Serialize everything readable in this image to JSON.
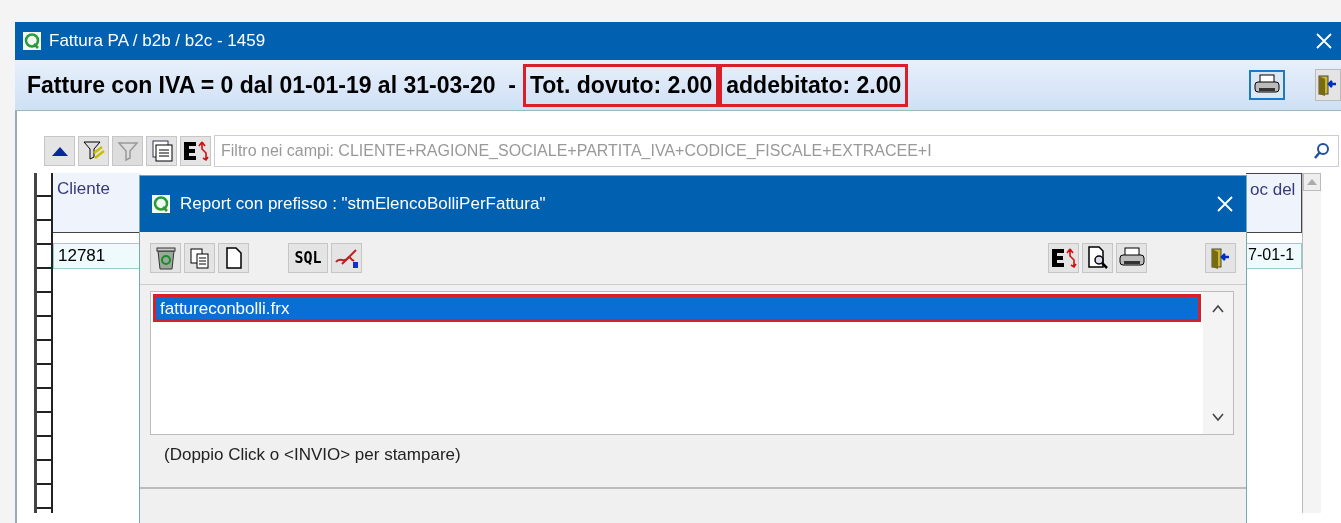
{
  "window": {
    "title": "Fattura PA / b2b / b2c - 1459"
  },
  "header": {
    "segments": [
      {
        "text": "Fatture con IVA = 0 dal 01-01-19 al 31-03-20  -",
        "highlighted": false
      },
      {
        "text": "Tot. dovuto: 2.00",
        "highlighted": true
      },
      {
        "text": "addebitato: 2.00",
        "highlighted": true
      }
    ]
  },
  "filter": {
    "placeholder": "Filtro nei campi: CLIENTE+RAGIONE_SOCIALE+PARTITA_IVA+CODICE_FISCALE+EXTRACEE+I"
  },
  "grid": {
    "columns": [
      "Cliente",
      "oc del"
    ],
    "rows": [
      [
        "12781",
        "7-01-1"
      ]
    ]
  },
  "dialog": {
    "title": "Report con prefisso : \"stmElencoBolliPerFattura\"",
    "sql_button": "SQL",
    "items": [
      {
        "label": "fattureconbolli.frx",
        "selected": true,
        "highlighted": true
      }
    ],
    "hint": "(Doppio Click o <INVIO> per stampare)"
  }
}
